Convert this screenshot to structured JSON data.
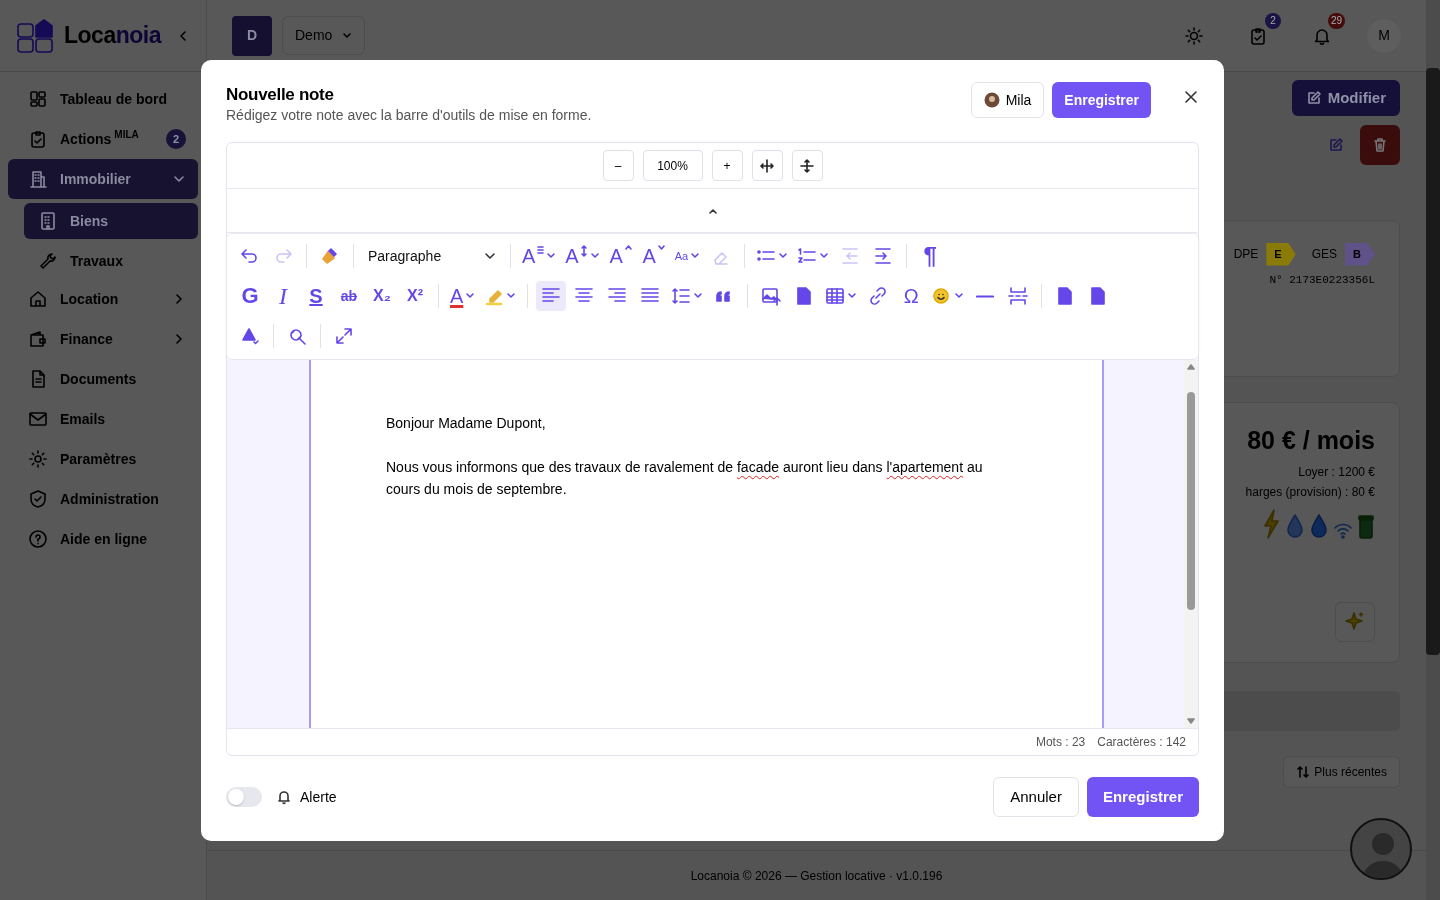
{
  "sidebar": {
    "logo": [
      "Loca",
      "noia"
    ],
    "items": [
      {
        "label": "Tableau de bord",
        "selected": false
      },
      {
        "label": "Actions",
        "sup": "MILA",
        "badge": "2",
        "selected": false
      },
      {
        "label": "Immobilier",
        "selected": true,
        "expanded": true,
        "children": [
          {
            "label": "Biens",
            "selected": true
          },
          {
            "label": "Travaux",
            "selected": false
          }
        ]
      },
      {
        "label": "Location",
        "selected": false,
        "expanded": false
      },
      {
        "label": "Finance",
        "selected": false,
        "expanded": false
      },
      {
        "label": "Documents",
        "selected": false
      },
      {
        "label": "Emails",
        "selected": false
      },
      {
        "label": "Paramètres",
        "selected": false
      },
      {
        "label": "Administration",
        "selected": false
      },
      {
        "label": "Aide en ligne",
        "selected": false
      }
    ]
  },
  "header": {
    "workspace_initial": "D",
    "workspace": "Demo",
    "tasks_badge": "2",
    "notifications_badge": "29",
    "user_initial": "M"
  },
  "property": {
    "edit_button": "Modifier",
    "energy": [
      {
        "label": "DPE",
        "grade": "E",
        "color": "#8a7a08"
      },
      {
        "label": "GES",
        "grade": "B",
        "color": "#5e5288"
      }
    ],
    "dpe_number": "N° 2173E0223356L",
    "total": "80 € / mois",
    "rent": "Loyer : 1200 €",
    "charges": "harges (provision) : 80 €"
  },
  "notes_sort": "Plus récentes",
  "footer": "Locanoia © 2026 — Gestion locative · v1.0.196",
  "modal": {
    "title": "Nouvelle note",
    "subtitle": "Rédigez votre note avec la barre d'outils de mise en forme.",
    "author": "Mila",
    "save": "Enregistrer",
    "zoom": {
      "out": "–",
      "value": "100%",
      "in": "+"
    },
    "toolbar": [
      [
        [
          {
            "kind": "undo"
          },
          {
            "kind": "redo",
            "disabled": true
          }
        ],
        [
          {
            "kind": "painter"
          }
        ],
        [
          {
            "kind": "select",
            "label": "Paragraphe"
          }
        ],
        [
          {
            "kind": "fontfamily",
            "label": "A",
            "dropdown": true
          },
          {
            "kind": "fontsize",
            "label": "A",
            "dropdown": true
          },
          {
            "kind": "grow",
            "label": "A"
          },
          {
            "kind": "shrink",
            "label": "A"
          },
          {
            "kind": "case",
            "label": "Aa",
            "dropdown": true
          },
          {
            "kind": "eraser",
            "disabled": true
          }
        ],
        [
          {
            "kind": "bullets",
            "dropdown": true
          },
          {
            "kind": "numbers",
            "dropdown": true
          },
          {
            "kind": "outdent",
            "disabled": true
          },
          {
            "kind": "indent"
          }
        ],
        [
          {
            "kind": "pilcrow",
            "label": "¶"
          }
        ]
      ],
      [
        [
          {
            "kind": "bold",
            "label": "G"
          },
          {
            "kind": "italic",
            "label": "I"
          },
          {
            "kind": "underline",
            "label": "S"
          },
          {
            "kind": "strike",
            "label": "ab"
          },
          {
            "kind": "sub",
            "label": "X₂"
          },
          {
            "kind": "sup",
            "label": "X²"
          }
        ],
        [
          {
            "kind": "color",
            "label": "A",
            "dropdown": true
          },
          {
            "kind": "highlight",
            "dropdown": true
          }
        ],
        [
          {
            "kind": "alignleft",
            "selected": true
          },
          {
            "kind": "aligncenter",
            "selected": false
          },
          {
            "kind": "alignright",
            "selected": false
          },
          {
            "kind": "justify",
            "selected": false
          },
          {
            "kind": "lineheight",
            "dropdown": true
          },
          {
            "kind": "quote"
          }
        ],
        [
          {
            "kind": "image"
          },
          {
            "kind": "page"
          },
          {
            "kind": "table",
            "dropdown": true
          },
          {
            "kind": "link"
          },
          {
            "kind": "symbol",
            "label": "Ω"
          },
          {
            "kind": "emoji",
            "dropdown": true
          },
          {
            "kind": "rule"
          },
          {
            "kind": "pagebreak"
          }
        ],
        [
          {
            "kind": "page"
          },
          {
            "kind": "page"
          }
        ]
      ],
      [
        [
          {
            "kind": "fill"
          }
        ],
        [
          {
            "kind": "replace"
          }
        ],
        [
          {
            "kind": "fullscreen"
          }
        ]
      ]
    ],
    "paragraphs": [
      [
        {
          "text": "Bonjour Madame Dupont,"
        }
      ],
      [
        {
          "text": "Nous vous informons que des travaux de ravalement de "
        },
        {
          "text": "facade",
          "misspelled": true
        },
        {
          "text": " auront lieu dans "
        },
        {
          "text": "l'apartement",
          "misspelled": true
        },
        {
          "text": " au cours du mois de septembre."
        }
      ]
    ],
    "words": "Mots : 23",
    "chars": "Caractères : 142",
    "alert": {
      "label": "Alerte",
      "on": false
    },
    "cancel": "Annuler",
    "confirm": "Enregistrer"
  }
}
